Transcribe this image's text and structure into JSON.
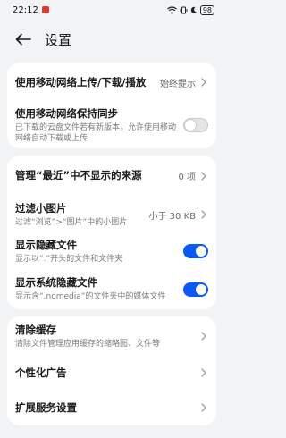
{
  "status_bar": {
    "time": "22:12",
    "battery": "98"
  },
  "header": {
    "title": "设置"
  },
  "group1": {
    "mobile_transfer": {
      "title": "使用移动网络上传/下载/播放",
      "value": "始终提示"
    },
    "mobile_sync": {
      "title": "使用移动网络保持同步",
      "subtitle": "已下载的云盘文件若有新版本，允许使用移动网络自动下载或上传"
    }
  },
  "group2": {
    "manage_recent": {
      "title": "管理“最近”中不显示的来源",
      "value": "0 项"
    },
    "filter_images": {
      "title": "过滤小图片",
      "subtitle": "过滤“浏览”>“图片”中的小图片",
      "value": "小于 30 KB"
    },
    "show_hidden": {
      "title": "显示隐藏文件",
      "subtitle": "显示以“.”开头的文件和文件夹"
    },
    "show_system_hidden": {
      "title": "显示系统隐藏文件",
      "subtitle": "显示含“.nomedia”的文件夹中的媒体文件"
    }
  },
  "group3": {
    "clear_cache": {
      "title": "清除缓存",
      "subtitle": "清除文件管理应用缓存的缩略图、文件等"
    },
    "personalized_ads": {
      "title": "个性化广告"
    },
    "extension_services": {
      "title": "扩展服务设置"
    }
  },
  "colors": {
    "accent": "#0a59f7",
    "background": "#f1f3f5"
  }
}
